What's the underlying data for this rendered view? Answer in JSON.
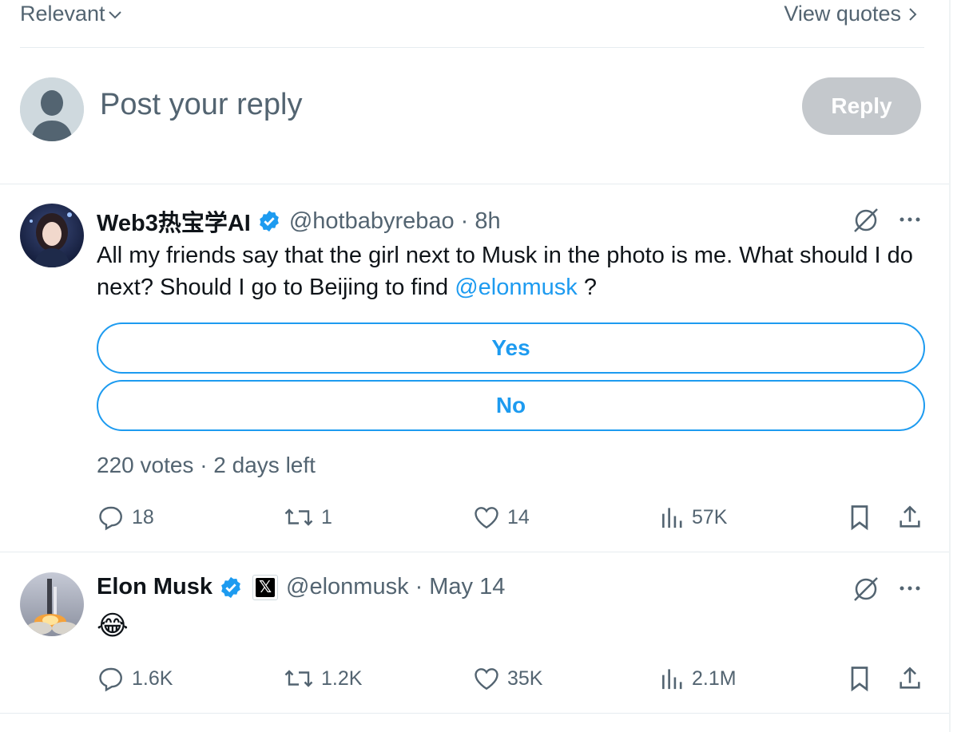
{
  "top_bar": {
    "sort_label": "Relevant",
    "view_quotes_label": "View quotes"
  },
  "composer": {
    "placeholder": "Post your reply",
    "reply_button": "Reply"
  },
  "tweets": [
    {
      "name": "Web3热宝学AI",
      "handle": "@hotbabyrebao",
      "separator": "·",
      "time": "8h",
      "text_before": "All my friends say that the girl next to Musk in the photo is me. What should I do next? Should I go to Beijing to find ",
      "mention": "@elonmusk",
      "text_after": " ?",
      "poll": {
        "options": [
          "Yes",
          "No"
        ],
        "meta": "220 votes · 2 days left"
      },
      "stats": {
        "replies": "18",
        "reposts": "1",
        "likes": "14",
        "views": "57K"
      }
    },
    {
      "name": "Elon Musk",
      "handle": "@elonmusk",
      "separator": "·",
      "time": "May 14",
      "badge": "𝕏",
      "text": "😂",
      "stats": {
        "replies": "1.6K",
        "reposts": "1.2K",
        "likes": "35K",
        "views": "2.1M"
      }
    }
  ],
  "icons": {
    "verified_color": "#1d9bf0",
    "accent_color": "#1d9bf0",
    "muted_color": "#536471"
  }
}
